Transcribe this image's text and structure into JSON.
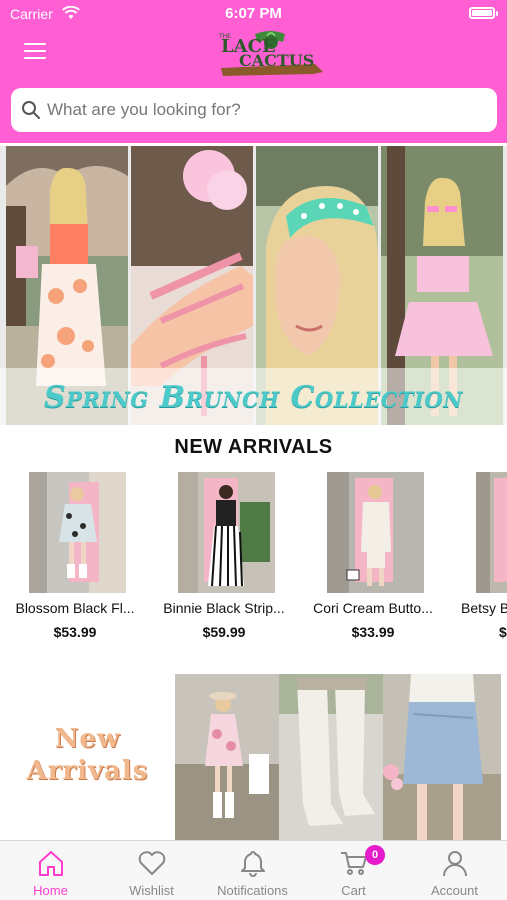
{
  "status_bar": {
    "carrier": "Carrier",
    "time": "6:07 PM"
  },
  "header": {
    "logo_icon": "lace-cactus-logo",
    "background_color": "#ff5fd2"
  },
  "search": {
    "placeholder": "What are you looking for?"
  },
  "banner": {
    "caption": "Spring Brunch Collection"
  },
  "new_arrivals": {
    "title": "NEW ARRIVALS",
    "products": [
      {
        "name": "Blossom Black Fl...",
        "price": "$53.99"
      },
      {
        "name": "Binnie Black Strip...",
        "price": "$59.99"
      },
      {
        "name": "Cori Cream Butto...",
        "price": "$33.99"
      },
      {
        "name": "Betsy B",
        "price": "$"
      }
    ]
  },
  "promo": {
    "line1": "New",
    "line2": "Arrivals"
  },
  "tabbar": {
    "accent_color": "#ff3ccf",
    "tabs": [
      {
        "label": "Home",
        "icon": "home-icon",
        "active": true
      },
      {
        "label": "Wishlist",
        "icon": "heart-icon",
        "active": false
      },
      {
        "label": "Notifications",
        "icon": "bell-icon",
        "active": false
      },
      {
        "label": "Cart",
        "icon": "cart-icon",
        "active": false,
        "badge": "0"
      },
      {
        "label": "Account",
        "icon": "person-icon",
        "active": false
      }
    ]
  }
}
